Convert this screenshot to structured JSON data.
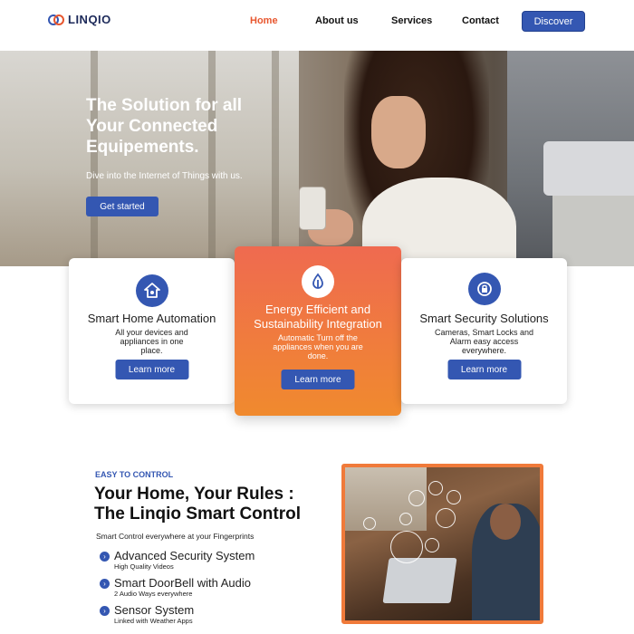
{
  "nav": {
    "logo_text": "LINQIO",
    "links": [
      {
        "label": "Home",
        "active": true
      },
      {
        "label": "About us",
        "active": false
      },
      {
        "label": "Services",
        "active": false
      },
      {
        "label": "Contact",
        "active": false
      }
    ],
    "cta_label": "Discover"
  },
  "hero": {
    "title": "The Solution for all Your Connected Equipements.",
    "subtitle": "Dive into the Internet of Things with us.",
    "cta_label": "Get started"
  },
  "cards": [
    {
      "title": "Smart Home Automation",
      "description": "All your devices and appliances in one place.",
      "button": "Learn more",
      "icon": "home-shield-icon"
    },
    {
      "title": "Energy Efficient and Sustainability Integration",
      "description": "Automatic Turn off the appliances when you are done.",
      "button": "Learn more",
      "icon": "leaf-drop-icon"
    },
    {
      "title": "Smart Security Solutions",
      "description": "Cameras, Smart Locks and Alarm easy access everywhere.",
      "button": "Learn more",
      "icon": "security-lock-icon"
    }
  ],
  "control": {
    "eyebrow": "EASY TO CONTROL",
    "title_line1": "Your Home, Your Rules :",
    "title_line2": "The Linqio Smart Control",
    "subtitle": "Smart Control everywhere at your Fingerprints",
    "features": [
      {
        "title": "Advanced Security System",
        "sub": "High Quality Videos"
      },
      {
        "title": "Smart DoorBell with Audio",
        "sub": "2 Audio Ways everywhere"
      },
      {
        "title": "Sensor System",
        "sub": "Linked with Weather Apps"
      }
    ]
  },
  "colors": {
    "accent": "#3457b2",
    "active_link": "#e8562e",
    "orange_gradient_top": "#ef6a50",
    "orange_gradient_bottom": "#f08a2e"
  }
}
